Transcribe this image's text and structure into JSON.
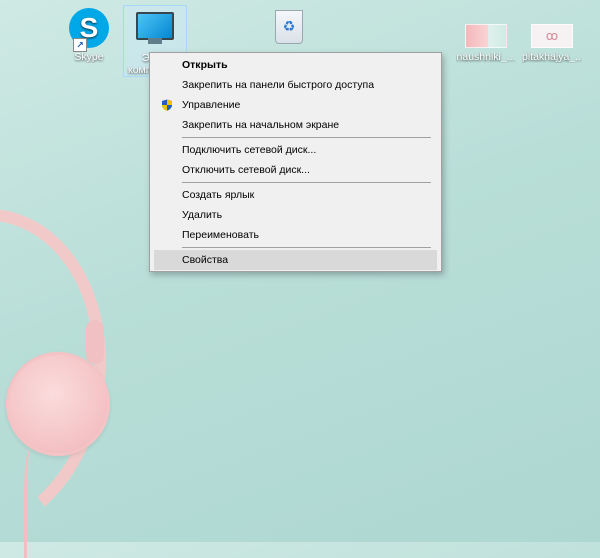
{
  "desktop": {
    "icons": [
      {
        "label": "Skype",
        "glyph": "S"
      },
      {
        "label": "Этот компьютер",
        "label_line1": "Э",
        "label_line2": "комп"
      },
      {
        "label": "",
        "glyph": "♻"
      },
      {
        "label": "naushniki_...",
        "glyph": ""
      },
      {
        "label": "pitakhajya_...",
        "glyph": "ꝏ"
      }
    ]
  },
  "context_menu": {
    "items": [
      {
        "label": "Открыть",
        "bold": true
      },
      {
        "label": "Закрепить на панели быстрого доступа"
      },
      {
        "label": "Управление",
        "icon": "uac-shield-icon"
      },
      {
        "label": "Закрепить на начальном экране"
      },
      {
        "label": "Подключить сетевой диск..."
      },
      {
        "label": "Отключить сетевой диск..."
      },
      {
        "label": "Создать ярлык"
      },
      {
        "label": "Удалить"
      },
      {
        "label": "Переименовать"
      },
      {
        "label": "Свойства",
        "highlighted": true
      }
    ]
  },
  "colors": {
    "menu_bg": "#f0f0f0",
    "menu_highlight": "#d9d9d9",
    "skype": "#00a8e8",
    "uac_blue": "#1f5fbf",
    "uac_yellow": "#f2c200"
  }
}
